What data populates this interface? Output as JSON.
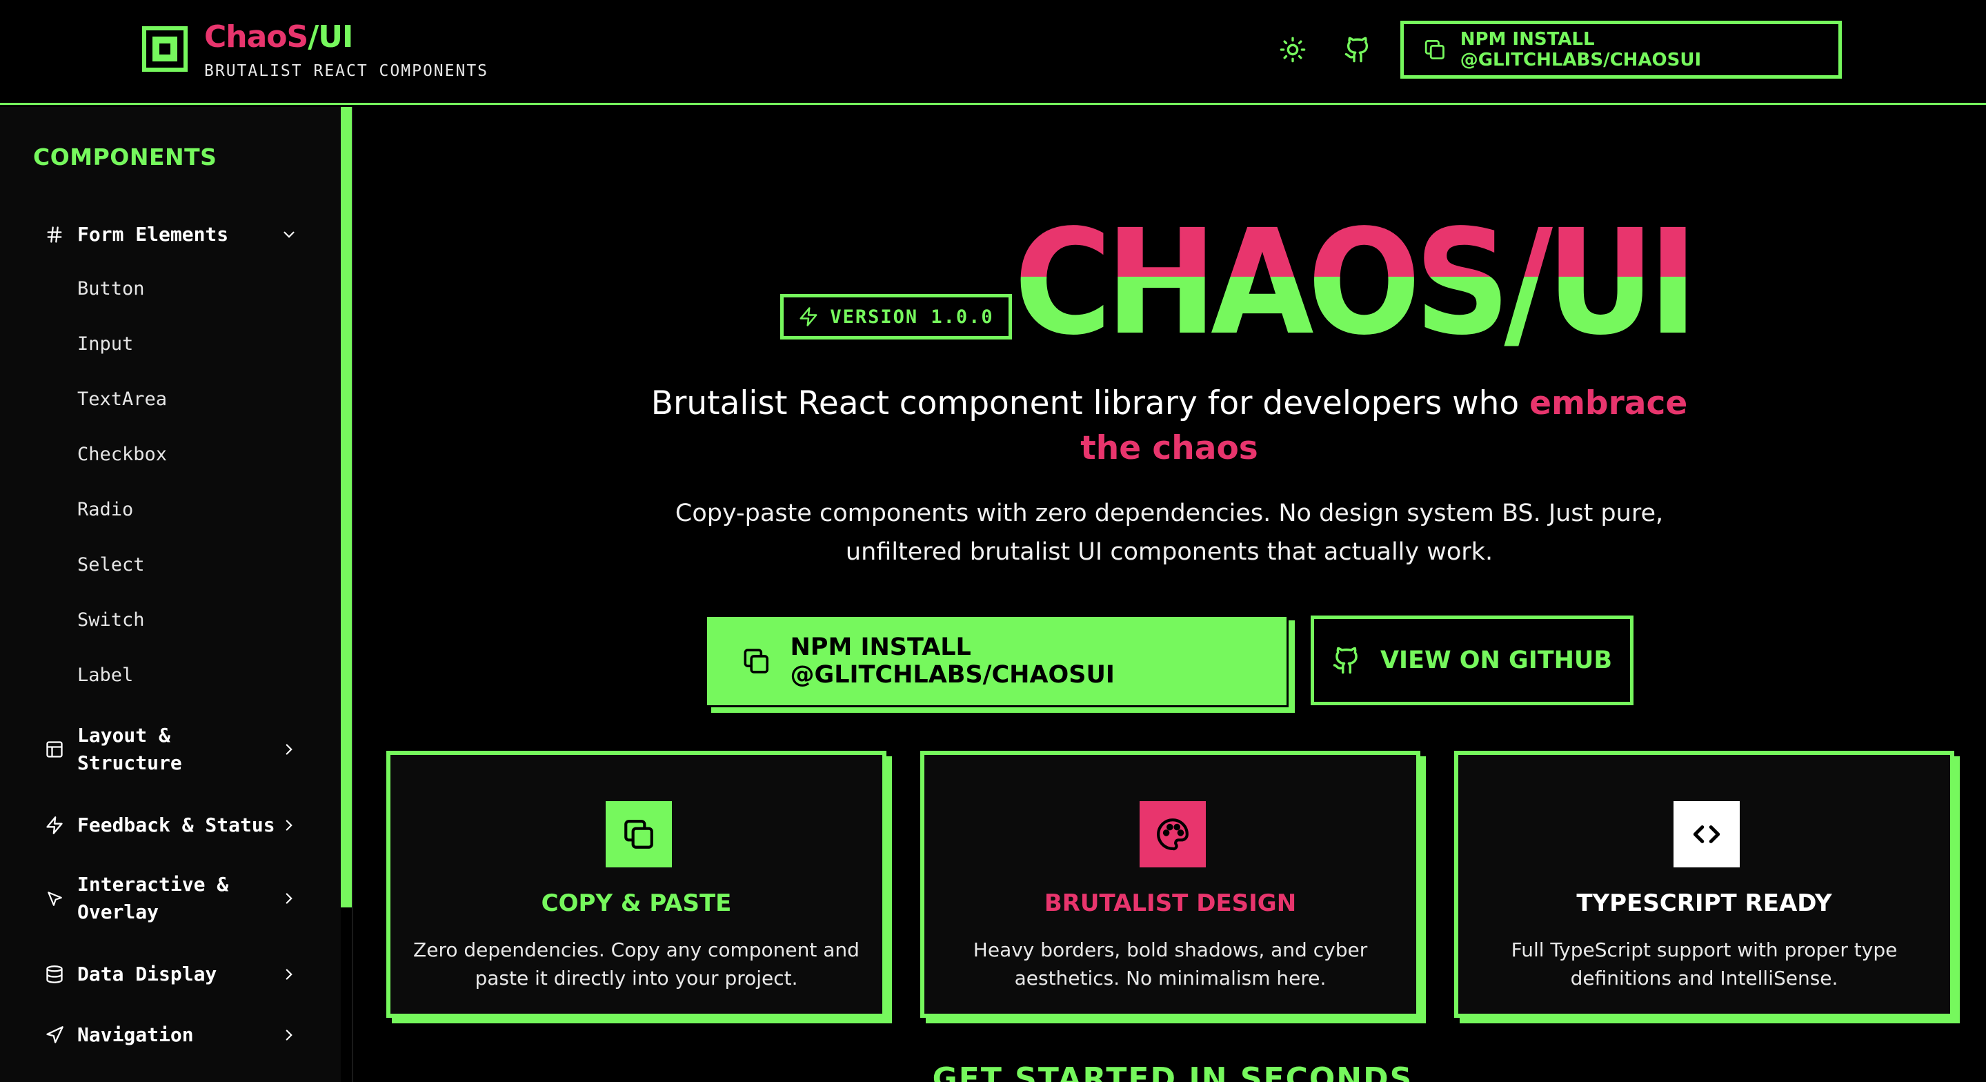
{
  "header": {
    "brand_part1": "ChaoS",
    "brand_part2": "/UI",
    "subtitle": "BRUTALIST REACT COMPONENTS",
    "theme_icon": "sun-icon",
    "github_icon": "github-icon",
    "install_label": "NPM INSTALL @GLITCHLABS/CHAOSUI"
  },
  "sidebar": {
    "heading": "COMPONENTS",
    "groups": [
      {
        "label": "Form Elements",
        "icon": "hash-icon",
        "expanded": true,
        "items": [
          "Button",
          "Input",
          "TextArea",
          "Checkbox",
          "Radio",
          "Select",
          "Switch",
          "Label"
        ]
      },
      {
        "label1": "Layout &",
        "label2": "Structure",
        "icon": "layout-icon"
      },
      {
        "label": "Feedback & Status",
        "icon": "lightning-icon"
      },
      {
        "label1": "Interactive &",
        "label2": "Overlay",
        "icon": "cursor-icon"
      },
      {
        "label": "Data Display",
        "icon": "database-icon"
      },
      {
        "label": "Navigation",
        "icon": "navigation-icon"
      }
    ]
  },
  "hero": {
    "version": "VERSION 1.0.0",
    "title": "CHAOS/UI",
    "tagline_main": "Brutalist React component library for developers who ",
    "tagline_accent": "embrace the chaos",
    "description": "Copy-paste components with zero dependencies. No design system BS. Just pure, unfiltered brutalist UI components that actually work.",
    "install_button": "NPM INSTALL @GLITCHLABS/CHAOSUI",
    "github_button": "VIEW ON GITHUB"
  },
  "features": [
    {
      "title": "COPY & PASTE",
      "text": "Zero dependencies. Copy any component and paste it directly into your project.",
      "icon": "copy-icon",
      "accent": "#76f85d"
    },
    {
      "title": "BRUTALIST DESIGN",
      "text": "Heavy borders, bold shadows, and cyber aesthetics. No minimalism here.",
      "icon": "palette-icon",
      "accent": "#e8356d"
    },
    {
      "title": "TYPESCRIPT READY",
      "text": "Full TypeScript support with proper type definitions and IntelliSense.",
      "icon": "code-icon",
      "accent": "#ffffff"
    }
  ],
  "next_section": "GET STARTED IN SECONDS",
  "colors": {
    "green": "#76f85d",
    "pink": "#e8356d",
    "background": "#000000"
  }
}
